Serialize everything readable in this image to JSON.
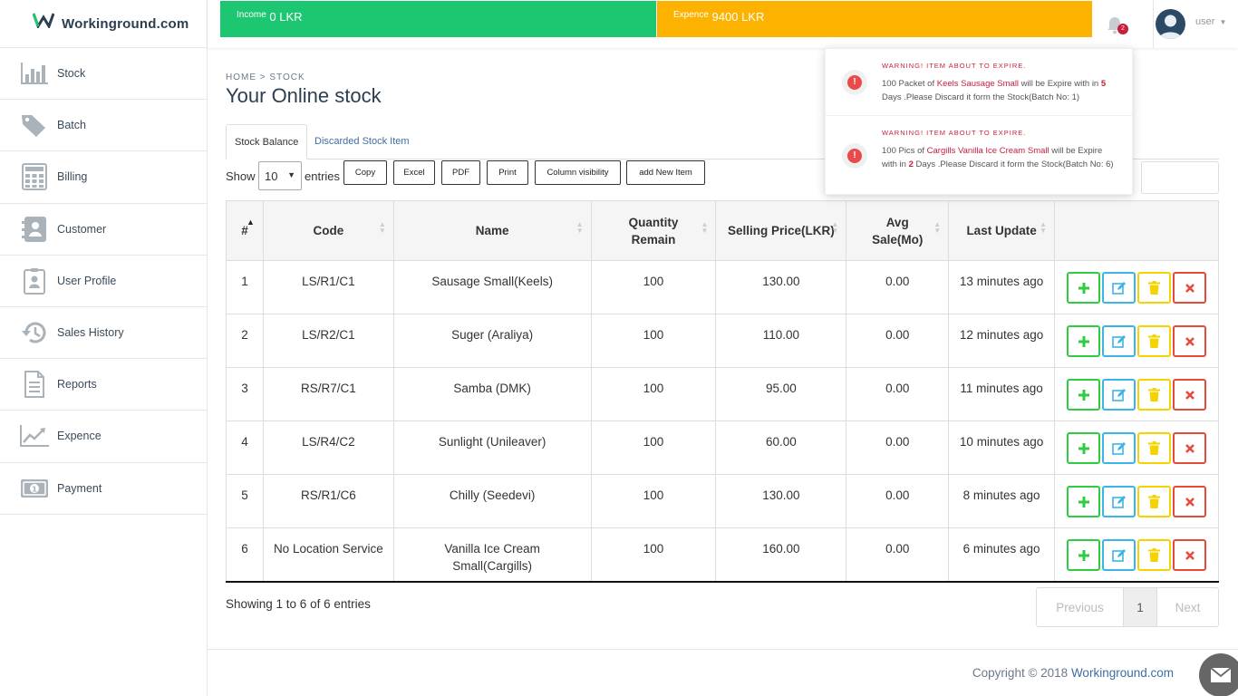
{
  "app": {
    "logo_text": "Workinground.com"
  },
  "sidebar": {
    "items": [
      {
        "label": "Stock",
        "icon": "bar-chart-icon"
      },
      {
        "label": "Batch",
        "icon": "tags-icon"
      },
      {
        "label": "Billing",
        "icon": "calculator-icon"
      },
      {
        "label": "Customer",
        "icon": "contact-card-icon"
      },
      {
        "label": "User Profile",
        "icon": "id-badge-icon"
      },
      {
        "label": "Sales History",
        "icon": "history-icon"
      },
      {
        "label": "Reports",
        "icon": "document-icon"
      },
      {
        "label": "Expence",
        "icon": "line-chart-icon"
      },
      {
        "label": "Payment",
        "icon": "money-icon"
      }
    ]
  },
  "topbar": {
    "income_label": "Income",
    "income_value": "0 LKR",
    "expense_label": "Expence",
    "expense_value": "9400 LKR",
    "notification_count": "2",
    "user_name": "user",
    "colors": {
      "income": "#1dc670",
      "expense": "#fdb200"
    }
  },
  "notifications": [
    {
      "title": "WARNING! ITEM ABOUT TO EXPIRE.",
      "t1": "100 Packet of ",
      "item": "Keels Sausage Small",
      "t2": " will be Expire with in ",
      "days": "5",
      "t3": " Days .Please Discard it form the Stock(Batch No: 1)"
    },
    {
      "title": "WARNING! ITEM ABOUT TO EXPIRE.",
      "t1": "100 Pics of ",
      "item": "Cargills Vanilla Ice Cream Small",
      "t2": " will be Expire with in ",
      "days": "2",
      "t3": " Days .Please Discard it form the Stock(Batch No: 6)"
    }
  ],
  "page": {
    "breadcrumb": "HOME > STOCK",
    "title": "Your Online stock",
    "tabs": [
      "Stock Balance",
      "Discarded Stock Item"
    ]
  },
  "controls": {
    "show_label": "Show",
    "entries_value": "10",
    "entries_label": "entries",
    "buttons": [
      "Copy",
      "Excel",
      "PDF",
      "Print",
      "Column visibility",
      "add New Item"
    ]
  },
  "table": {
    "headers": [
      "#",
      "Code",
      "Name",
      "Quantity Remain",
      "Selling Price(LKR)",
      "Avg Sale(Mo)",
      "Last Update",
      ""
    ],
    "rows": [
      [
        "1",
        "LS/R1/C1",
        "Sausage Small(Keels)",
        "100",
        "130.00",
        "0.00",
        "13 minutes ago"
      ],
      [
        "2",
        "LS/R2/C1",
        "Suger (Araliya)",
        "100",
        "110.00",
        "0.00",
        "12 minutes ago"
      ],
      [
        "3",
        "RS/R7/C1",
        "Samba (DMK)",
        "100",
        "95.00",
        "0.00",
        "11 minutes ago"
      ],
      [
        "4",
        "LS/R4/C2",
        "Sunlight (Unileaver)",
        "100",
        "60.00",
        "0.00",
        "10 minutes ago"
      ],
      [
        "5",
        "RS/R1/C6",
        "Chilly (Seedevi)",
        "100",
        "130.00",
        "0.00",
        "8 minutes ago"
      ],
      [
        "6",
        "No Location Service",
        "Vanilla Ice Cream Small(Cargills)",
        "100",
        "160.00",
        "0.00",
        "6 minutes ago"
      ]
    ]
  },
  "pagination": {
    "info": "Showing 1 to 6 of 6 entries",
    "previous": "Previous",
    "current": "1",
    "next": "Next"
  },
  "footer": {
    "text": "Copyright © 2018 ",
    "link": "Workinground.com"
  }
}
